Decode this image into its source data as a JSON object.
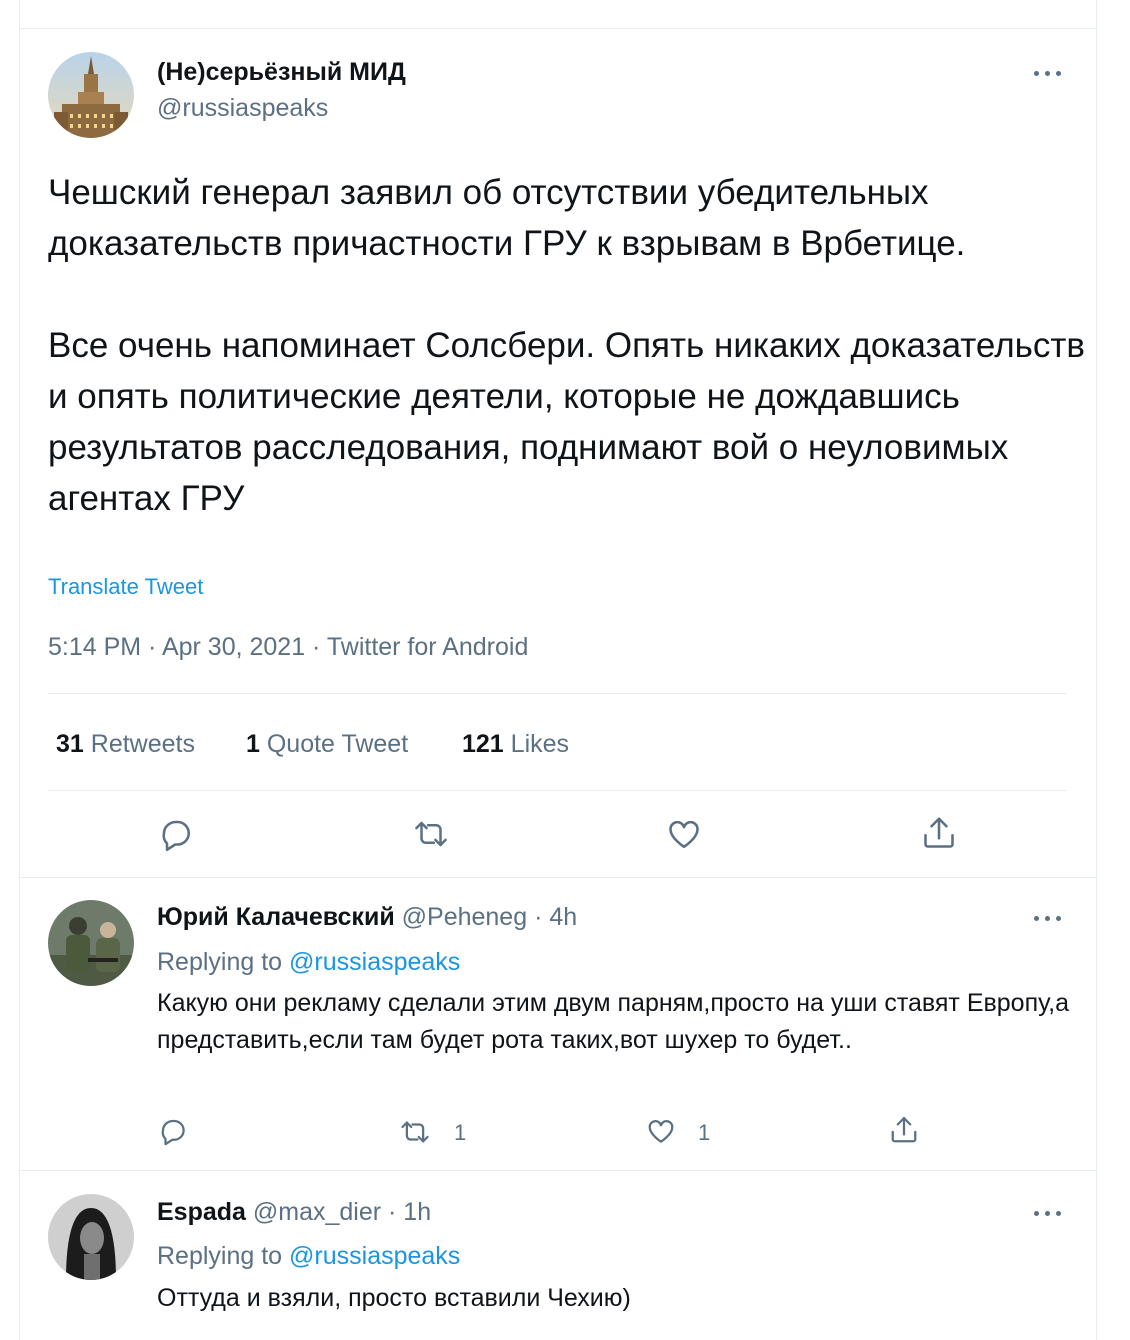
{
  "main_tweet": {
    "display_name": "(Не)серьёзный МИД",
    "handle": "@russiaspeaks",
    "text": "Чешский генерал заявил об отсутствии убедительных доказательств причастности ГРУ к взрывам в Врбетице.\n\nВсе очень напоминает Солсбери. Опять никаких доказательств и опять политические деятели, которые не дождавшись результатов расследования, поднимают вой о неуловимых агентах ГРУ",
    "translate_label": "Translate Tweet",
    "meta": "5:14 PM · Apr 30, 2021 · Twitter for Android",
    "stats": {
      "retweets_count": "31",
      "retweets_label": "Retweets",
      "quotes_count": "1",
      "quotes_label": "Quote Tweet",
      "likes_count": "121",
      "likes_label": "Likes"
    },
    "actions": [
      "reply-icon",
      "retweet-icon",
      "like-icon",
      "share-icon"
    ]
  },
  "replies": [
    {
      "display_name": "Юрий Калачевский",
      "handle_time": "@Peheneg · 4h",
      "replying_prefix": "Replying to",
      "replying_handle": "@russiaspeaks",
      "text": "Какую они рекламу сделали этим двум парням,просто на уши ставят Европу,а представить,если там будет рота таких,вот шухер то будет..",
      "retweet_count": "1",
      "like_count": "1"
    },
    {
      "display_name": "Espada",
      "handle_time": "@max_dier · 1h",
      "replying_prefix": "Replying to",
      "replying_handle": "@russiaspeaks",
      "text": "Оттуда и взяли, просто вставили Чехию)"
    }
  ],
  "colors": {
    "accent": "#1b95e0",
    "muted": "#5b7083",
    "border": "#e6ecf0",
    "text": "#0f1419"
  }
}
